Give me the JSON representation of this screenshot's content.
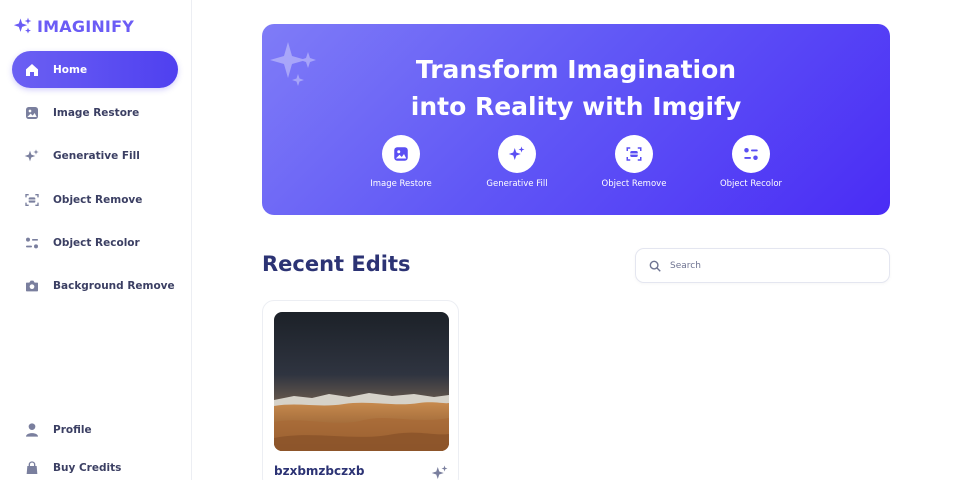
{
  "app": {
    "name": "IMAGINIFY",
    "icon": "sparkle-icon",
    "brand_color": "#6b5cf5"
  },
  "sidebar": {
    "items": [
      {
        "label": "Home",
        "icon": "home-icon",
        "active": true
      },
      {
        "label": "Image Restore",
        "icon": "image-icon",
        "active": false
      },
      {
        "label": "Generative Fill",
        "icon": "stars-icon",
        "active": false
      },
      {
        "label": "Object Remove",
        "icon": "scan-icon",
        "active": false
      },
      {
        "label": "Object Recolor",
        "icon": "filter-icon",
        "active": false
      },
      {
        "label": "Background Remove",
        "icon": "camera-icon",
        "active": false
      }
    ],
    "bottom_items": [
      {
        "label": "Profile",
        "icon": "user-icon"
      },
      {
        "label": "Buy Credits",
        "icon": "bag-icon"
      }
    ],
    "active_gradient": [
      "#6b60f3",
      "#4f40f0"
    ]
  },
  "hero": {
    "title_line1": "Transform Imagination",
    "title_line2": "into Reality with Imgify",
    "gradient": [
      "#7f7cf7",
      "#4a2cf5"
    ],
    "features": [
      {
        "label": "Image Restore",
        "icon": "image-icon"
      },
      {
        "label": "Generative Fill",
        "icon": "stars-icon"
      },
      {
        "label": "Object Remove",
        "icon": "scan-icon"
      },
      {
        "label": "Object Recolor",
        "icon": "filter-icon"
      }
    ]
  },
  "recent": {
    "title": "Recent Edits",
    "search_placeholder": "Search",
    "cards": [
      {
        "name": "bzxbmzbczxb",
        "badge_icon": "stars-icon"
      }
    ]
  },
  "colors": {
    "icon": "#7a7f9e",
    "heading": "#2c3374",
    "accent": "#5a4ff3"
  }
}
